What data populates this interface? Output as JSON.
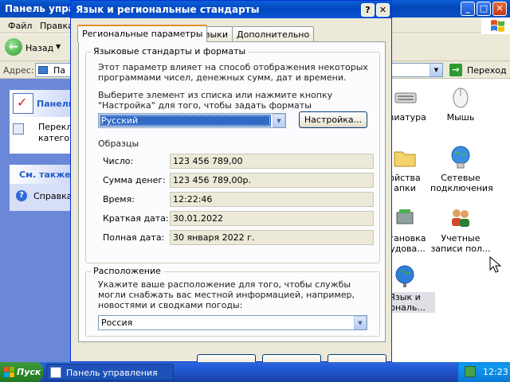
{
  "background_window": {
    "title": "Панель упра",
    "menu": [
      "Файл",
      "Правка"
    ],
    "toolbar": {
      "back_label": "Назад"
    },
    "address": {
      "label": "Адрес:",
      "value": "Па",
      "go_label": "Переход"
    },
    "task_pane": {
      "panel_title": "Панель",
      "switch_line1": "Переклн",
      "switch_line2": "категор",
      "see_also_title": "См. также",
      "help_label": "Справка"
    },
    "icons": [
      {
        "icon": "keyboard-icon",
        "line1": "авиатура",
        "line2": ""
      },
      {
        "icon": "mouse-icon",
        "line1": "Мышь",
        "line2": ""
      },
      {
        "icon": "folder-options-icon",
        "line1": "ойства",
        "line2": "апки"
      },
      {
        "icon": "network-connections-icon",
        "line1": "Сетевые",
        "line2": "подключения"
      },
      {
        "icon": "add-hardware-icon",
        "line1": "становка",
        "line2": "рудова..."
      },
      {
        "icon": "user-accounts-icon",
        "line1": "Учетные",
        "line2": "записи пол..."
      },
      {
        "icon": "regional-options-icon",
        "line1": "Язык и",
        "line2": "иональ..."
      }
    ]
  },
  "dialog": {
    "title": "Язык и региональные стандарты",
    "help_button": "?",
    "close_button": "✕",
    "tabs": [
      "Региональные параметры",
      "Языки",
      "Дополнительно"
    ],
    "formats_group": {
      "caption": "Языковые стандарты и форматы",
      "description": "Этот параметр влияет на способ отображения некоторых программами чисел, денежных сумм, дат и времени.",
      "instruction": "Выберите элемент из списка или нажмите кнопку \"Настройка\" для того, чтобы задать форматы самостоятельно:",
      "selected_locale": "Русский",
      "customize_button": "Настройка...",
      "samples_label": "Образцы",
      "samples": [
        {
          "label": "Число:",
          "value": "123 456 789,00"
        },
        {
          "label": "Сумма денег:",
          "value": "123 456 789,00р."
        },
        {
          "label": "Время:",
          "value": "12:22:46"
        },
        {
          "label": "Краткая дата:",
          "value": "30.01.2022"
        },
        {
          "label": "Полная дата:",
          "value": "30 января 2022 г."
        }
      ]
    },
    "location_group": {
      "caption": "Расположение",
      "description": "Укажите ваше расположение для того, чтобы службы могли снабжать вас местной информацией, например, новостями и сводками погоды:",
      "selected_location": "Россия"
    }
  },
  "taskbar": {
    "start_label": "Пуск",
    "active_window": "Панель управления",
    "clock": "12:23"
  }
}
